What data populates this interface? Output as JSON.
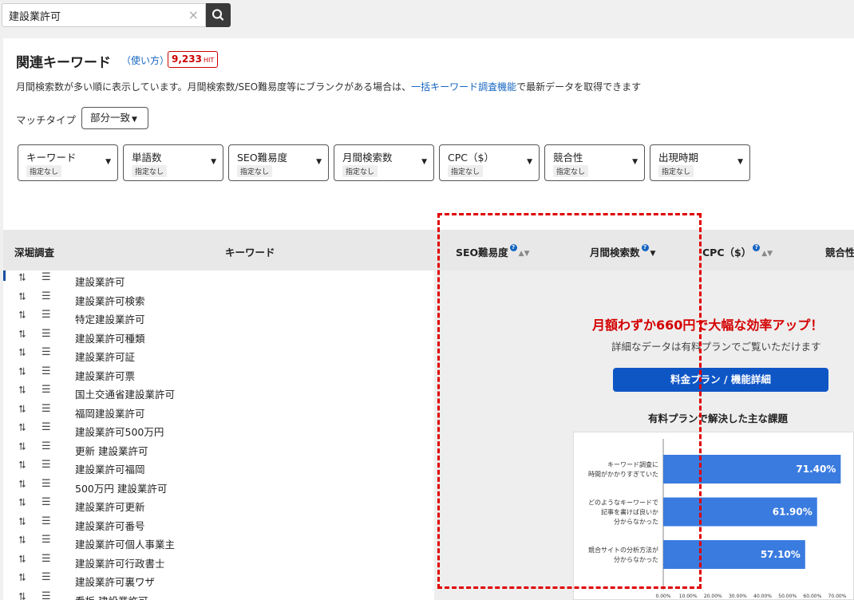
{
  "search": {
    "value": "建設業許可",
    "clear": "×"
  },
  "header": {
    "title": "関連キーワード",
    "howto": "（使い方）",
    "hit_count": "9,233",
    "hit_unit": "HIT",
    "desc_before": "月間検索数が多い順に表示しています。月間検索数/SEO難易度等にブランクがある場合は、",
    "desc_link": "一括キーワード調査機能",
    "desc_after": "で最新データを取得できます"
  },
  "match": {
    "label": "マッチタイプ",
    "value": "部分一致",
    "caret": "▼"
  },
  "filters": [
    {
      "label": "キーワード",
      "chip": "指定なし"
    },
    {
      "label": "単語数",
      "chip": "指定なし"
    },
    {
      "label": "SEO難易度",
      "chip": "指定なし"
    },
    {
      "label": "月間検索数",
      "chip": "指定なし"
    },
    {
      "label": "CPC（$）",
      "chip": "指定なし"
    },
    {
      "label": "競合性",
      "chip": "指定なし"
    },
    {
      "label": "出現時期",
      "chip": "指定なし"
    }
  ],
  "columns": {
    "deep": "深堀調査",
    "keyword": "キーワード",
    "seo": "SEO難易度",
    "volume": "月間検索数",
    "cpc": "CPC（$）",
    "competition": "競合性"
  },
  "rows": [
    "建設業許可",
    "建設業許可検索",
    "特定建設業許可",
    "建設業許可種類",
    "建設業許可証",
    "建設業許可票",
    "国土交通省建設業許可",
    "福岡建設業許可",
    "建設業許可500万円",
    "更新 建設業許可",
    "建設業許可福岡",
    "500万円 建設業許可",
    "建設業許可更新",
    "建設業許可番号",
    "建設業許可個人事業主",
    "建設業許可行政書士",
    "建設業許可裏ワザ",
    "看板 建設業許可"
  ],
  "promo": {
    "title": "月額わずか660円で大幅な効率アップ！",
    "subtitle": "詳細なデータは有料プランでご覧いただけます",
    "button": "料金プラン / 機能詳細",
    "chart_title": "有料プランで解決した主な課題"
  },
  "colors": {
    "accent": "#0f56c5",
    "promo_red": "#d40000",
    "bar": "#3a7be0",
    "annotation": "#e00000"
  },
  "chart_data": {
    "type": "bar",
    "orientation": "horizontal",
    "categories": [
      [
        "キーワード調査に",
        "時間がかかりすぎていた"
      ],
      [
        "どのようなキーワードで",
        "記事を書けば良いか",
        "分からなかった"
      ],
      [
        "競合サイトの分析方法が",
        "分からなかった"
      ]
    ],
    "values": [
      71.4,
      61.9,
      57.1
    ],
    "value_labels": [
      "71.40%",
      "61.90%",
      "57.10%"
    ],
    "xlim": [
      0,
      70
    ],
    "xticks": [
      "0.00%",
      "10.00%",
      "20.00%",
      "30.00%",
      "40.00%",
      "50.00%",
      "60.00%",
      "70.00%"
    ]
  }
}
